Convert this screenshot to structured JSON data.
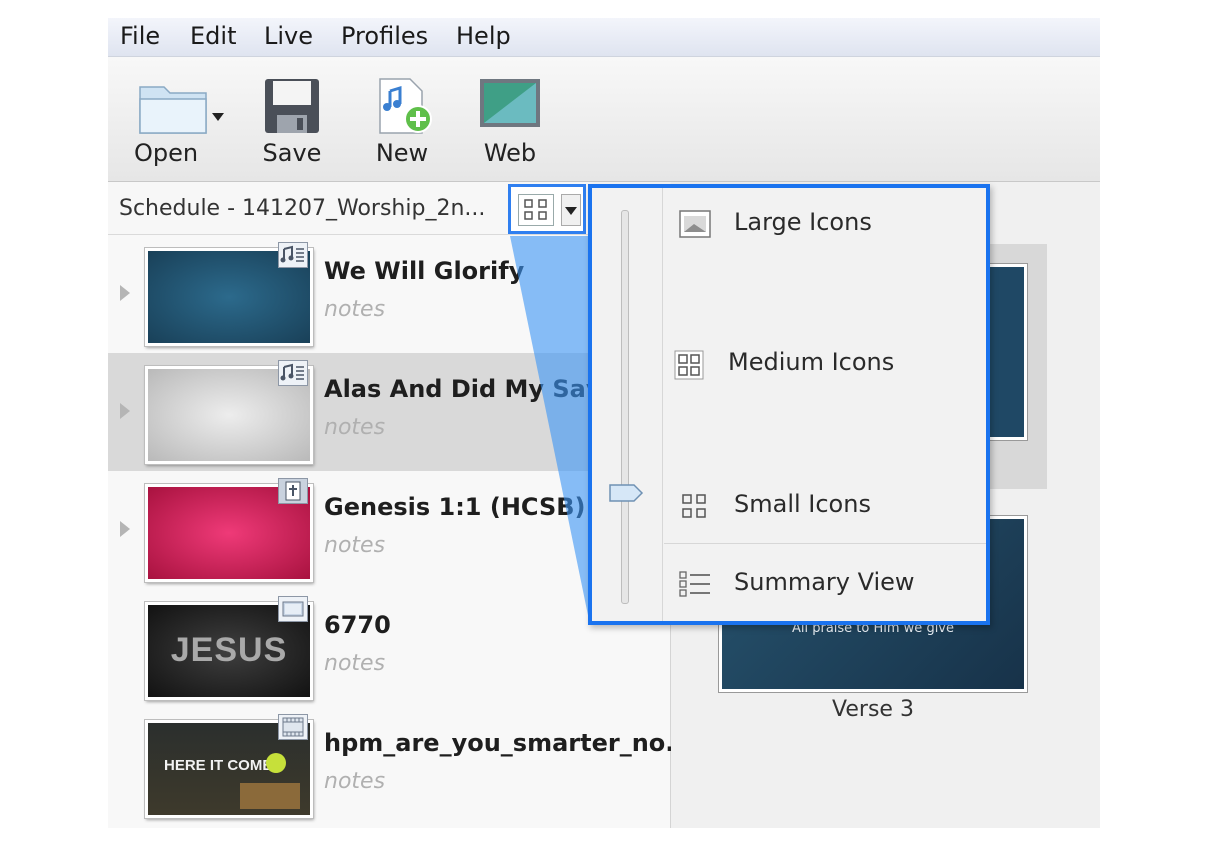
{
  "menu": [
    "File",
    "Edit",
    "Live",
    "Profiles",
    "Help"
  ],
  "toolbar": {
    "open_label": "Open",
    "save_label": "Save",
    "new_label": "New",
    "web_label": "Web"
  },
  "schedule": {
    "title": "Schedule - 141207_Worship_2n..."
  },
  "items": [
    {
      "title": "We Will Glorify",
      "notes": "notes",
      "badge_icon": "music-notes-icon"
    },
    {
      "title": "Alas And Did My Savio",
      "notes": "notes",
      "badge_icon": "music-notes-icon"
    },
    {
      "title": "Genesis 1:1 (HCSB)",
      "notes": "notes",
      "badge_icon": "bible-icon"
    },
    {
      "title": "6770",
      "notes": "notes",
      "badge_icon": "image-icon",
      "thumb_text": "JESUS"
    },
    {
      "title": "hpm_are_you_smarter_no...",
      "notes": "notes",
      "badge_icon": "video-icon",
      "thumb_text": "HERE IT COMES"
    }
  ],
  "view_menu": {
    "options": [
      "Large Icons",
      "Medium Icons",
      "Small Icons",
      "Summary View"
    ]
  },
  "slides": {
    "slide_text": "All praise to Him we give",
    "caption": "Verse 3"
  },
  "colors": {
    "accent": "#1a73ef",
    "selection": "#d9d9d9"
  }
}
